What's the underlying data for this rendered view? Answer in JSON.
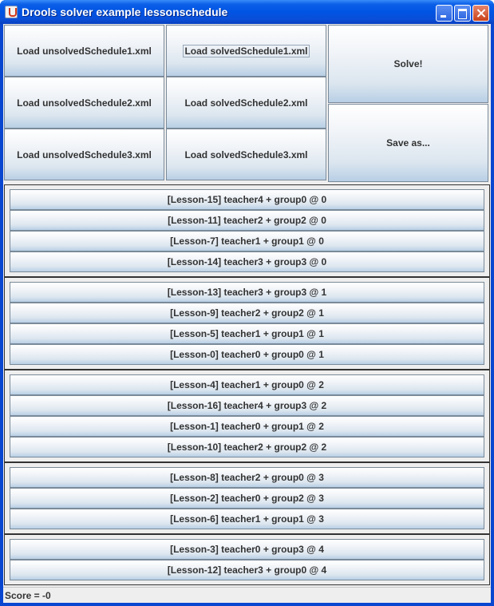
{
  "window": {
    "title": "Drools solver example lessonschedule",
    "icon": "java-cup-icon"
  },
  "toolbar": {
    "load_unsolved": [
      "Load unsolvedSchedule1.xml",
      "Load unsolvedSchedule2.xml",
      "Load unsolvedSchedule3.xml"
    ],
    "load_solved": [
      "Load solvedSchedule1.xml",
      "Load solvedSchedule2.xml",
      "Load solvedSchedule3.xml"
    ],
    "solve_label": "Solve!",
    "save_label": "Save as..."
  },
  "schedule": [
    {
      "timeslot": 0,
      "lessons": [
        "[Lesson-15] teacher4 + group0 @ 0",
        "[Lesson-11] teacher2 + group2 @ 0",
        "[Lesson-7] teacher1 + group1 @ 0",
        "[Lesson-14] teacher3 + group3 @ 0"
      ]
    },
    {
      "timeslot": 1,
      "lessons": [
        "[Lesson-13] teacher3 + group3 @ 1",
        "[Lesson-9] teacher2 + group2 @ 1",
        "[Lesson-5] teacher1 + group1 @ 1",
        "[Lesson-0] teacher0 + group0 @ 1"
      ]
    },
    {
      "timeslot": 2,
      "lessons": [
        "[Lesson-4] teacher1 + group0 @ 2",
        "[Lesson-16] teacher4 + group3 @ 2",
        "[Lesson-1] teacher0 + group1 @ 2",
        "[Lesson-10] teacher2 + group2 @ 2"
      ]
    },
    {
      "timeslot": 3,
      "lessons": [
        "[Lesson-8] teacher2 + group0 @ 3",
        "[Lesson-2] teacher0 + group2 @ 3",
        "[Lesson-6] teacher1 + group1 @ 3"
      ]
    },
    {
      "timeslot": 4,
      "lessons": [
        "[Lesson-3] teacher0 + group3 @ 4",
        "[Lesson-12] teacher3 + group0 @ 4"
      ]
    }
  ],
  "status": {
    "score_text": "Score = -0"
  },
  "colors": {
    "titlebar": "#0054e3",
    "button_top": "#ffffff",
    "button_bottom": "#b8cfe5",
    "panel_border": "#333333",
    "background": "#eeeeee"
  }
}
